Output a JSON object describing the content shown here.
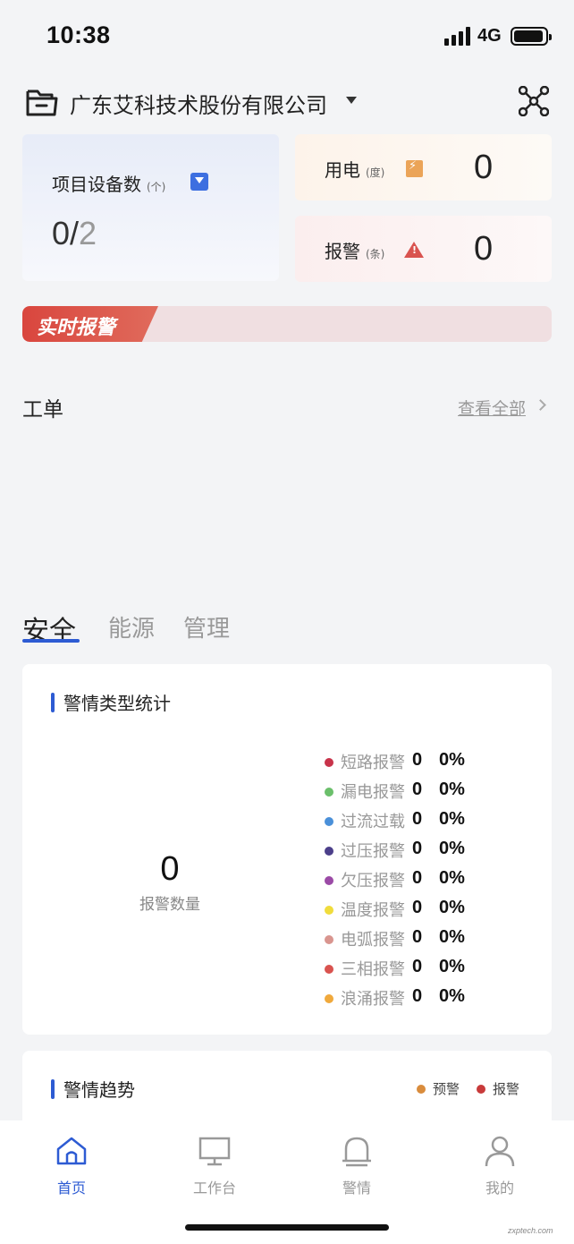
{
  "status_bar": {
    "time": "10:38",
    "network": "4G"
  },
  "header": {
    "company": "广东艾科技术股份有限公司"
  },
  "stats": {
    "devices": {
      "label": "项目设备数",
      "unit": "(个)",
      "online": "0/",
      "total": "2"
    },
    "power": {
      "label": "用电",
      "unit": "(度)",
      "value": "0"
    },
    "alarms": {
      "label": "报警",
      "unit": "(条)",
      "value": "0"
    }
  },
  "realtime_alarm": {
    "label": "实时报警"
  },
  "workorders": {
    "title": "工单",
    "view_all": "查看全部"
  },
  "tabs": [
    {
      "label": "安全",
      "active": true
    },
    {
      "label": "能源",
      "active": false
    },
    {
      "label": "管理",
      "active": false
    }
  ],
  "alert_types": {
    "title": "警情类型统计",
    "total": "0",
    "total_label": "报警数量",
    "items": [
      {
        "name": "短路报警",
        "count": "0",
        "percent": "0%",
        "color": "#c8334a"
      },
      {
        "name": "漏电报警",
        "count": "0",
        "percent": "0%",
        "color": "#6bbf6b"
      },
      {
        "name": "过流过载",
        "count": "0",
        "percent": "0%",
        "color": "#4a90d9"
      },
      {
        "name": "过压报警",
        "count": "0",
        "percent": "0%",
        "color": "#4b3f8a"
      },
      {
        "name": "欠压报警",
        "count": "0",
        "percent": "0%",
        "color": "#9b4aa6"
      },
      {
        "name": "温度报警",
        "count": "0",
        "percent": "0%",
        "color": "#f0dc3c"
      },
      {
        "name": "电弧报警",
        "count": "0",
        "percent": "0%",
        "color": "#d9958f"
      },
      {
        "name": "三相报警",
        "count": "0",
        "percent": "0%",
        "color": "#d9534f"
      },
      {
        "name": "浪涌报警",
        "count": "0",
        "percent": "0%",
        "color": "#f0a93c"
      }
    ]
  },
  "alert_trend": {
    "title": "警情趋势",
    "legend": [
      {
        "name": "预警",
        "color": "#d98c3c"
      },
      {
        "name": "报警",
        "color": "#c83a3a"
      }
    ]
  },
  "tab_bar": {
    "items": [
      {
        "label": "首页",
        "icon": "home-icon",
        "active": true
      },
      {
        "label": "工作台",
        "icon": "monitor-icon",
        "active": false
      },
      {
        "label": "警情",
        "icon": "bell-icon",
        "active": false
      },
      {
        "label": "我的",
        "icon": "user-icon",
        "active": false
      }
    ]
  },
  "watermark": "zxptech.com",
  "accent_color": "#2d5bd3"
}
